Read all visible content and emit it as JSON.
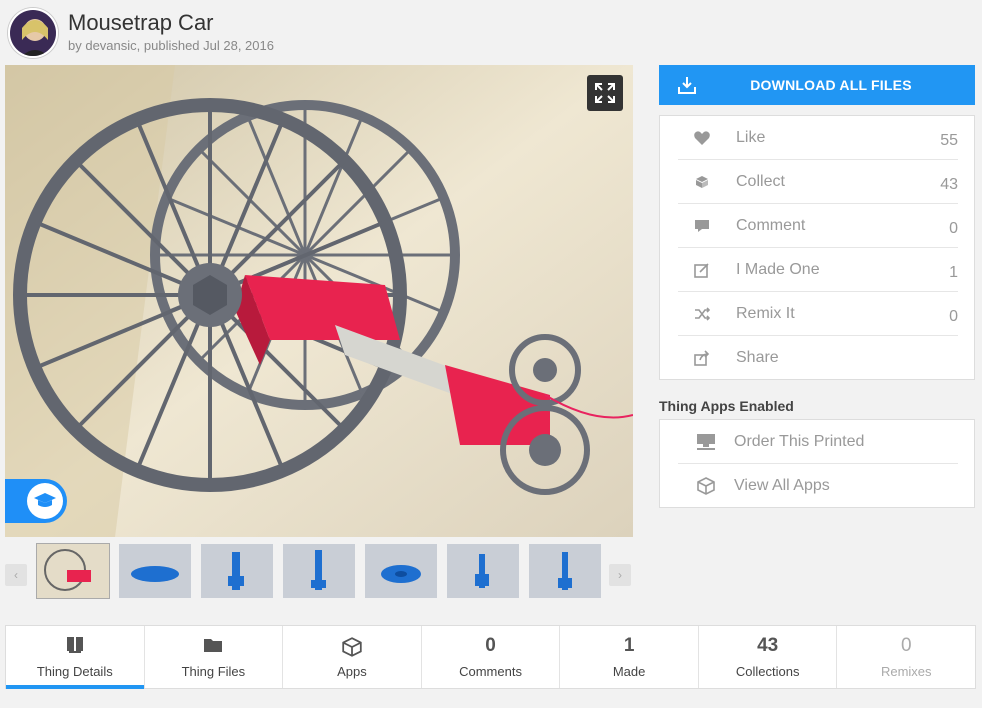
{
  "header": {
    "title": "Mousetrap Car",
    "byline": "by devansic, published Jul 28, 2016"
  },
  "download": {
    "label": "DOWNLOAD ALL FILES",
    "icon": "download-icon"
  },
  "actions": [
    {
      "label": "Like",
      "count": "55",
      "icon": "heart-icon"
    },
    {
      "label": "Collect",
      "count": "43",
      "icon": "collect-icon"
    },
    {
      "label": "Comment",
      "count": "0",
      "icon": "comment-icon"
    },
    {
      "label": "I Made One",
      "count": "1",
      "icon": "edit-icon"
    },
    {
      "label": "Remix It",
      "count": "0",
      "icon": "shuffle-icon"
    },
    {
      "label": "Share",
      "count": "",
      "icon": "share-icon"
    }
  ],
  "apps": {
    "heading": "Thing Apps Enabled",
    "items": [
      {
        "label": "Order This Printed",
        "icon": "printer-icon"
      },
      {
        "label": "View All Apps",
        "icon": "cube-icon"
      }
    ]
  },
  "tabs": [
    {
      "label": "Thing Details",
      "value": "",
      "icon": "book-icon",
      "active": true
    },
    {
      "label": "Thing Files",
      "value": "",
      "icon": "folder-icon"
    },
    {
      "label": "Apps",
      "value": "",
      "icon": "cube-icon"
    },
    {
      "label": "Comments",
      "value": "0"
    },
    {
      "label": "Made",
      "value": "1"
    },
    {
      "label": "Collections",
      "value": "43"
    },
    {
      "label": "Remixes",
      "value": "0",
      "muted": true
    }
  ],
  "colors": {
    "accent": "#2196f3",
    "part": "#e8234f",
    "wheel": "#6b6f78"
  }
}
